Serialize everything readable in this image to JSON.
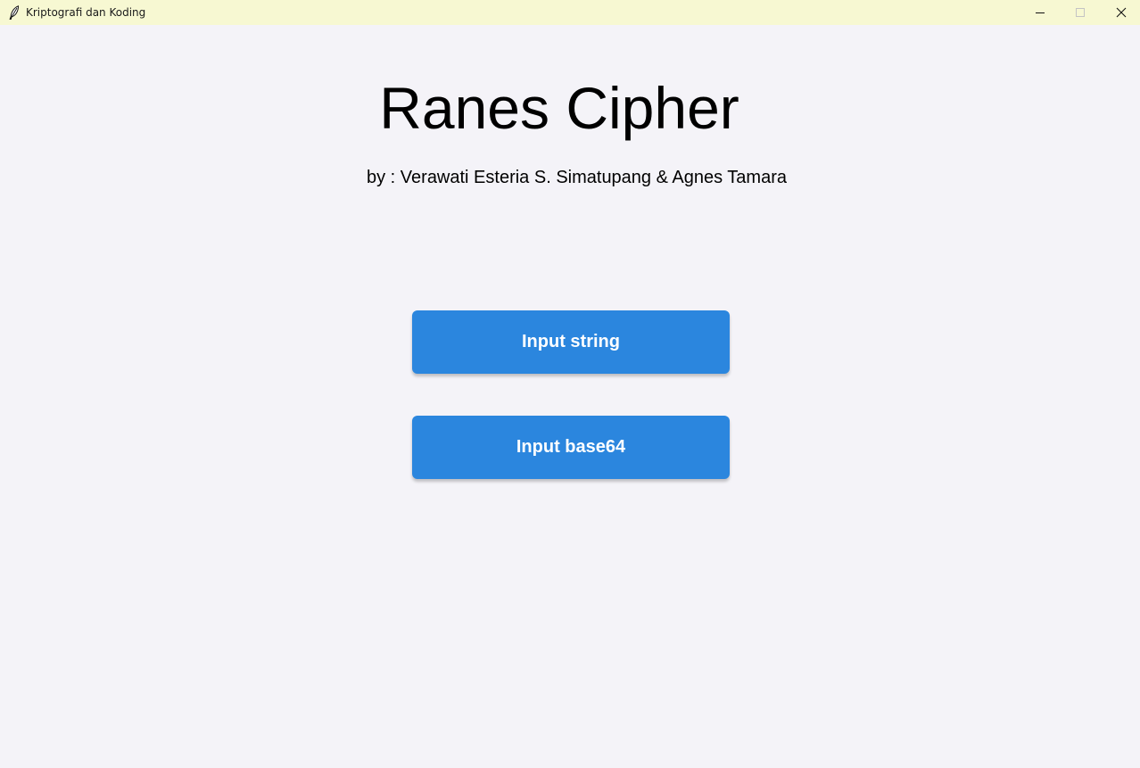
{
  "window": {
    "title": "Kriptografi dan Koding",
    "icon": "feather-icon",
    "controls": [
      "minimize-icon",
      "maximize-icon",
      "close-icon"
    ]
  },
  "main": {
    "heading": "Ranes Cipher",
    "subtitle": "by : Verawati Esteria S. Simatupang & Agnes Tamara",
    "buttons": [
      {
        "label": "Input string"
      },
      {
        "label": "Input base64"
      }
    ]
  },
  "colors": {
    "titlebar": "#f7f8d2",
    "background": "#f4f3f8",
    "button": "#2b86de",
    "button_text": "#ffffff"
  }
}
